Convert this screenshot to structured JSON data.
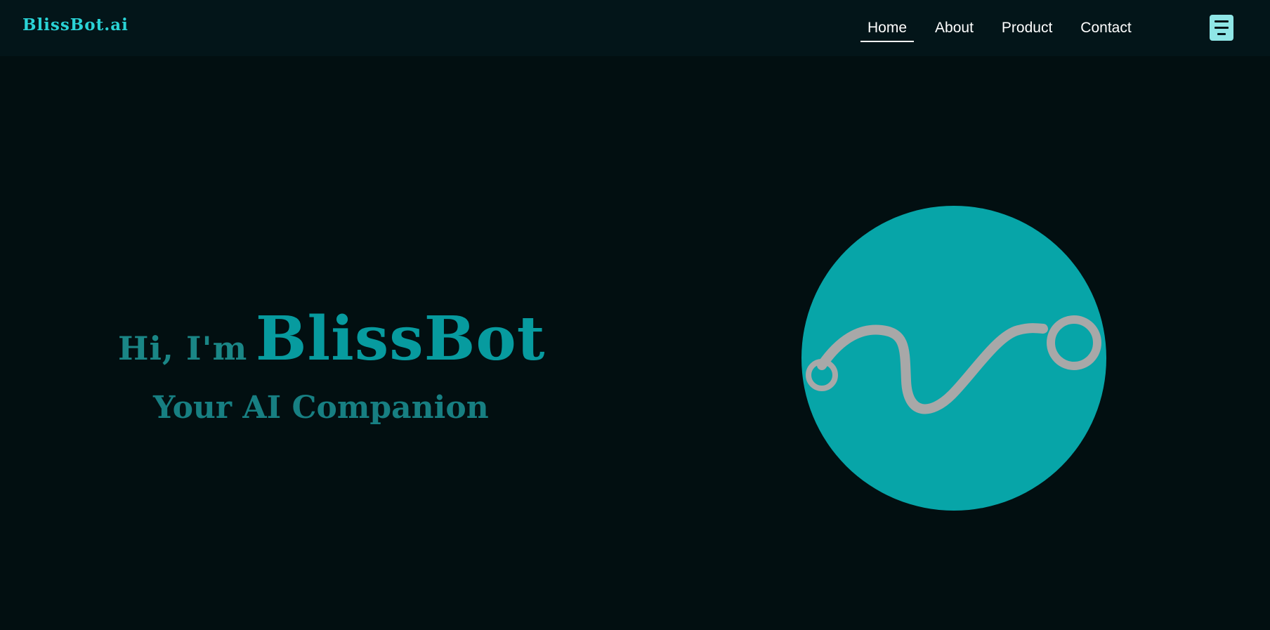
{
  "brand": {
    "logo_text": "BlissBot.ai"
  },
  "nav": {
    "links": [
      {
        "label": "Home",
        "active": true
      },
      {
        "label": "About",
        "active": false
      },
      {
        "label": "Product",
        "active": false
      },
      {
        "label": "Contact",
        "active": false
      }
    ],
    "menu_icon": "hamburger-menu-icon"
  },
  "hero": {
    "greeting": "Hi, I'm",
    "name": "BlissBot",
    "subtitle": "Your AI Companion",
    "illustration_icon": "bot-cable-orb-icon"
  },
  "colors": {
    "background": "#020f11",
    "navbar": "#031519",
    "accent": "#07a5a8",
    "logo": "#2ad3d6",
    "menu_button": "#8fe6e6",
    "cable": "#a8a8a8"
  }
}
